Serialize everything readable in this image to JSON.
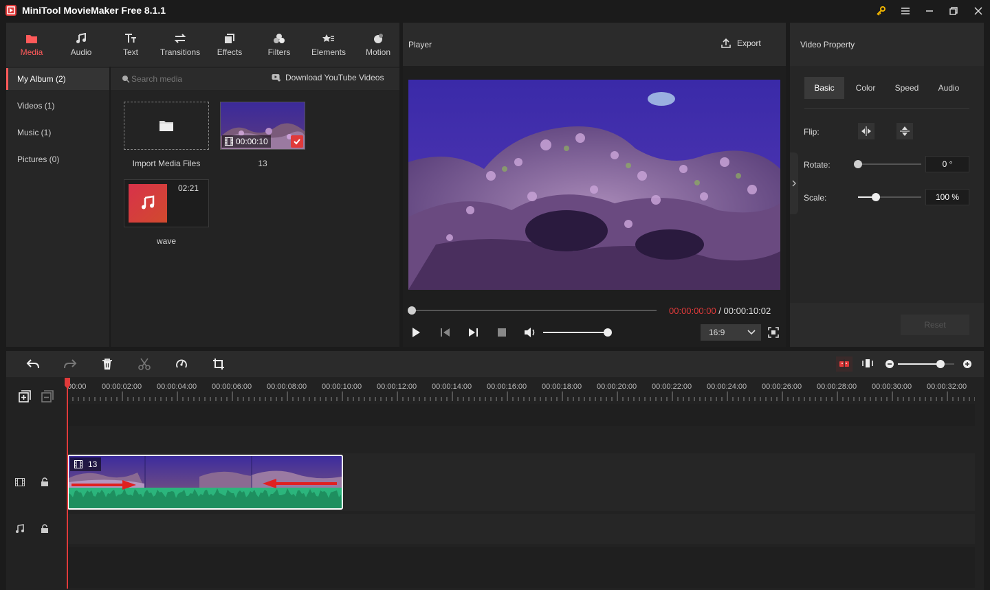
{
  "window": {
    "title": "MiniTool MovieMaker Free 8.1.1"
  },
  "nav": {
    "tabs": [
      {
        "label": "Media",
        "icon": "media-icon"
      },
      {
        "label": "Audio",
        "icon": "music-note-icon"
      },
      {
        "label": "Text",
        "icon": "text-icon"
      },
      {
        "label": "Transitions",
        "icon": "transitions-icon"
      },
      {
        "label": "Effects",
        "icon": "effects-icon"
      },
      {
        "label": "Filters",
        "icon": "filters-icon"
      },
      {
        "label": "Elements",
        "icon": "elements-icon"
      },
      {
        "label": "Motion",
        "icon": "motion-icon"
      }
    ],
    "active": "Media"
  },
  "sidebar": {
    "items": [
      {
        "label": "My Album (2)"
      },
      {
        "label": "Videos (1)"
      },
      {
        "label": "Music (1)"
      },
      {
        "label": "Pictures (0)"
      }
    ]
  },
  "media": {
    "search_placeholder": "Search media",
    "download_label": "Download YouTube Videos",
    "tiles": [
      {
        "label": "Import Media Files"
      },
      {
        "label": "13",
        "duration": "00:00:10"
      },
      {
        "label": "wave",
        "duration": "02:21"
      }
    ]
  },
  "player": {
    "title": "Player",
    "export_label": "Export",
    "current_time": "00:00:00:00",
    "separator": " / ",
    "total_time": "00:00:10:02",
    "aspect_ratio": "16:9",
    "progress": 0,
    "volume": 1
  },
  "property": {
    "title": "Video Property",
    "tabs": [
      "Basic",
      "Color",
      "Speed",
      "Audio"
    ],
    "active_tab": "Basic",
    "flip_label": "Flip:",
    "rotate_label": "Rotate:",
    "rotate_value": "0 °",
    "rotate_fraction": 0,
    "scale_label": "Scale:",
    "scale_value": "100 %",
    "scale_fraction": 0.28,
    "reset_label": "Reset"
  },
  "timeline": {
    "ruler": [
      "00:00",
      "00:00:02:00",
      "00:00:04:00",
      "00:00:06:00",
      "00:00:08:00",
      "00:00:10:00",
      "00:00:12:00",
      "00:00:14:00",
      "00:00:16:00",
      "00:00:18:00",
      "00:00:20:00",
      "00:00:22:00",
      "00:00:24:00",
      "00:00:26:00",
      "00:00:28:00",
      "00:00:30:00",
      "00:00:32:00"
    ],
    "clip_label": "13",
    "zoom_level": 0.75
  },
  "colors": {
    "accent": "#ff5a5a",
    "audio_wave": "#2bb57c",
    "clip_border": "#ffffff",
    "arrow": "#e02020"
  }
}
